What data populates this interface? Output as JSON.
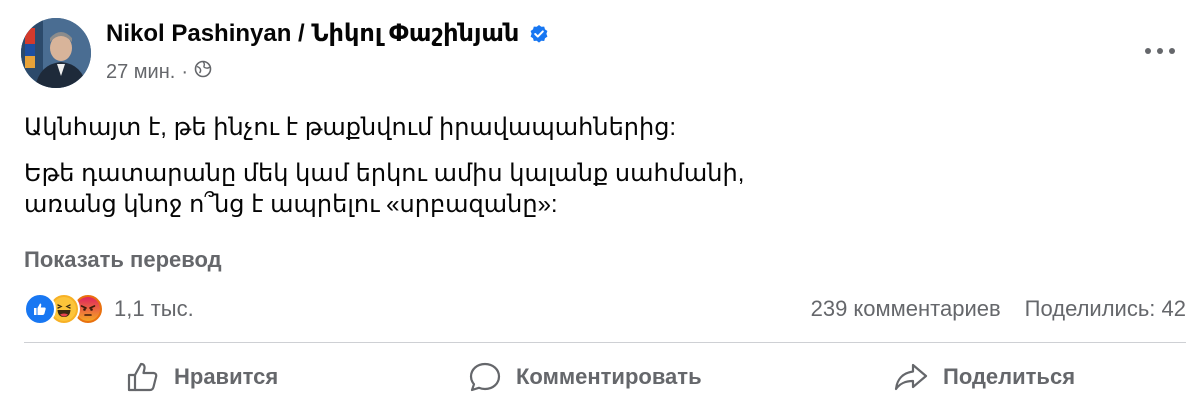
{
  "post": {
    "author": "Nikol Pashinyan / Նիկոլ Փաշինյան",
    "time": "27 мин.",
    "meta_separator": "·",
    "paragraphs": [
      "Ակնհայտ է, թե ինչու է թաքնվում իրավապահներից:",
      "Եթե դատարանը մեկ կամ երկու ամիս կալանք սահմանի, առանց կնոջ ո՞նց է ապրելու «սրբազանը»:"
    ],
    "translate_link": "Показать перевод"
  },
  "engagement": {
    "reaction_count": "1,1 тыс.",
    "comments": "239 комментариев",
    "shares": "Поделились: 42"
  },
  "actions": {
    "like": "Нравится",
    "comment": "Комментировать",
    "share": "Поделиться"
  },
  "icons": [
    "verified-badge-icon",
    "globe-icon",
    "more-options-icon",
    "like-reaction-icon",
    "haha-reaction-icon",
    "angry-reaction-icon",
    "thumbs-up-icon",
    "comment-bubble-icon",
    "share-arrow-icon"
  ],
  "colors": {
    "accent": "#1877f2",
    "secondary_text": "#65676b",
    "divider": "#ced0d4"
  }
}
